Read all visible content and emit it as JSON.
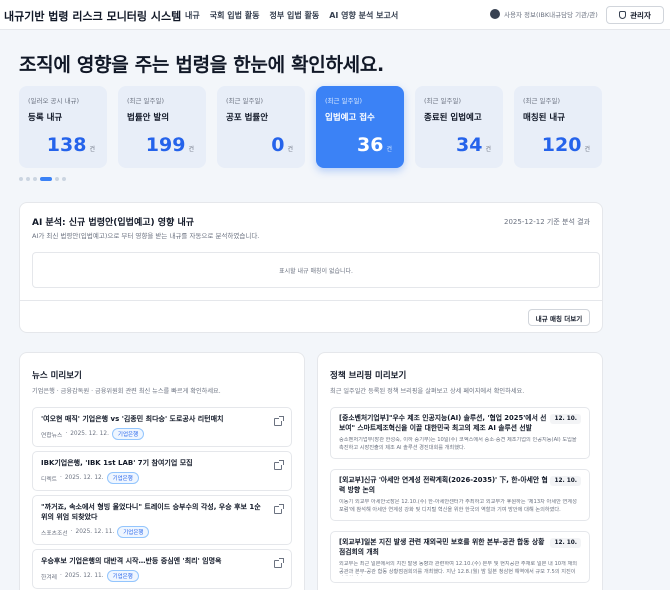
{
  "header": {
    "title": "내규기반 법령 리스크 모니터링 시스템",
    "nav": [
      "내규",
      "국회 입법 활동",
      "정부 입법 활동",
      "AI 영향 분석 보고서"
    ],
    "user_info": "사용자 정보(IBK내규담당 기관/관)",
    "admin_label": "관리자"
  },
  "headline": "조직에 영향을 주는 법령을 한눈에 확인하세요.",
  "stats": [
    {
      "kicker": "(일러오 공시 내규)",
      "title": "등록 내규",
      "value": "138",
      "unit": "건"
    },
    {
      "kicker": "(최근 일주일)",
      "title": "법률안 발의",
      "value": "199",
      "unit": "건"
    },
    {
      "kicker": "(최근 일주일)",
      "title": "공포 법률안",
      "value": "0",
      "unit": "건"
    },
    {
      "kicker": "(최근 일주일)",
      "title": "입법예고 접수",
      "value": "36",
      "unit": "건"
    },
    {
      "kicker": "(최근 일주일)",
      "title": "종료된 입법예고",
      "value": "34",
      "unit": "건"
    },
    {
      "kicker": "(최근 일주일)",
      "title": "매칭된 내규",
      "value": "120",
      "unit": "건"
    }
  ],
  "ai": {
    "title": "AI 분석: 신규 법령안(입법예고) 영향 내규",
    "subtitle": "AI가 최신 법령안(입법예고)으로 부터 영향을 받는 내규를 자동으로 분석하였습니다.",
    "date": "2025-12-12 기준 분석 결과",
    "empty": "표시할 내규 매칭이 없습니다.",
    "more_label": "내규 매칭 더보기"
  },
  "news": {
    "title": "뉴스 미리보기",
    "subtitle": "기업은행 · 금융감독원 · 금융위원회 관련 최신 뉴스를 빠르게 확인하세요.",
    "items": [
      {
        "title": "'여오현 매직' 기업은행 vs '김종민 최다승' 도로공사 리턴매치",
        "source": "연합뉴스",
        "date": "2025. 12. 12.",
        "tag": "기업은행"
      },
      {
        "title": "IBK기업은행, 'IBK 1st LAB' 7기 참여기업 모집",
        "source": "디렉트",
        "date": "2025. 12. 12.",
        "tag": "기업은행"
      },
      {
        "title": "\"까거죠, 속소에서 형빙 울었다니\" 트레이드 승부수의 각성, 우승 후보 1순위의 위엄 되찾았다",
        "source": "스포츠조선",
        "date": "2025. 12. 11.",
        "tag": "기업은행"
      },
      {
        "title": "우승후보 기업은행의 대반격 시작…반등 중심엔 '최리' 임명옥",
        "source": "한겨레",
        "date": "2025. 12. 11.",
        "tag": "기업은행"
      }
    ]
  },
  "policy": {
    "title": "정책 브리핑 미리보기",
    "subtitle": "최근 일주일간 등록된 정책 브리핑을 살펴보고 상세 페이지에서 확인하세요.",
    "items": [
      {
        "title": "[중소벤처기업부]\"우수 제조 인공지능(AI) 솔루션, '협업 2025'에서 선보여\" 스마트제조혁신을 이끌 대한민국 최고의 제조 AI 솔루션 선발",
        "date": "12. 10.",
        "body": "중소벤처기업부(장관 한성숙, 이하 중기부)는 10일(수) 코엑스에서 중소·중견 제조기업의 인공지능(AI) 도입을 촉진하고 시장진출의 제조 AI 솔루션 경진대회를 개최했다."
      },
      {
        "title": "[외교부]신규 '아세안 연계성 전략계획(2026-2035)' 下, 한-아세안 협력 방향 논의",
        "date": "12. 10.",
        "body": "이동기 외교부 아세안국장은 12.10.(수) 한-아세안센터가 주최하고 외교부가 후원하는 '제13차 아세안 연계성 포럼'에 참석해 아세안 연계성 강화 및 디지털 혁신을 위한 한국의 역할과 기여 방안에 대해 논의하였다."
      },
      {
        "title": "[외교부]일본 지진 발생 관련 재외국민 보호를 위한 본부-공관 합동 상황점검회의 개최",
        "date": "12. 10.",
        "body": "외교부는 최근 일본에서의 지진 발생 동향과 관련하여 12.10.(수) 본부 및 현지공관 주재로 일본 내 10개 재외공관과 본부-공관 합동 상황점검회의를 개최했다. 지난 12.8.(월) 밤 일본 청삼현 해역에서 규모 7.5의 지진이 발생하였다."
      }
    ]
  }
}
